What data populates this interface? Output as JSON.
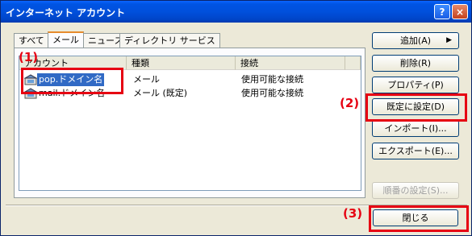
{
  "window": {
    "title": "インターネット アカウント",
    "help": "?",
    "close": "×"
  },
  "tabs": [
    "すべて",
    "メール",
    "ニュース",
    "ディレクトリ サービス"
  ],
  "columns": [
    "アカウント",
    "種類",
    "接続"
  ],
  "rows": [
    {
      "name": "pop.ドメイン名",
      "type": "メール",
      "conn": "使用可能な接続",
      "selected": true
    },
    {
      "name": "mail.ドメイン名",
      "type": "メール (既定)",
      "conn": "使用可能な接続",
      "selected": false
    }
  ],
  "buttons": {
    "add": "追加(A)",
    "add_arrow": "▶",
    "remove": "削除(R)",
    "properties": "プロパティ(P)",
    "set_default": "既定に設定(D)",
    "import": "インポート(I)...",
    "export": "エクスポート(E)...",
    "order": "順番の設定(S)...",
    "close": "閉じる"
  },
  "callouts": [
    "(1)",
    "(2)",
    "(3)"
  ],
  "colors": {
    "callout": "#e60012",
    "selection": "#316ac5",
    "title_bar": "#0054e3"
  }
}
